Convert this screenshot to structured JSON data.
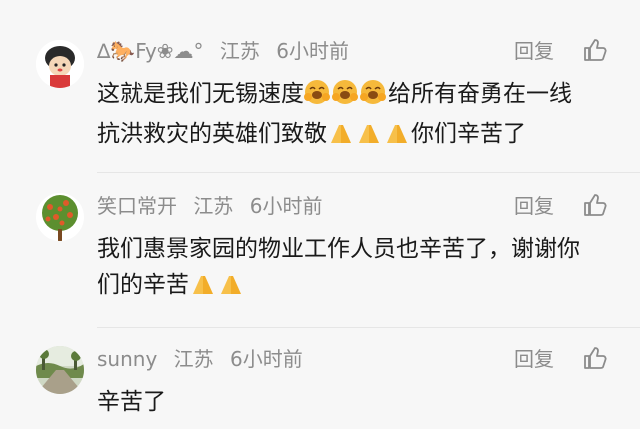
{
  "comments": [
    {
      "username": "∆🐎Fy❀☁°",
      "location": "江苏",
      "time": "6小时前",
      "reply_label": "回复",
      "text_line1": "这就是我们无锡速度",
      "text_line1_after": "给所有奋勇在一线",
      "text_line2": "抗洪救灾的英雄们致敬",
      "text_line2_after": "你们辛苦了"
    },
    {
      "username": "笑口常开",
      "location": "江苏",
      "time": "6小时前",
      "reply_label": "回复",
      "text_line1": "我们惠景家园的物业工作人员也辛苦了，谢谢你",
      "text_line2": "们的辛苦"
    },
    {
      "username": "sunny",
      "location": "江苏",
      "time": "6小时前",
      "reply_label": "回复",
      "text_line1": "辛苦了"
    }
  ]
}
